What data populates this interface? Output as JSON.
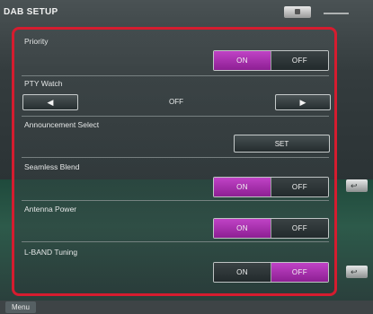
{
  "header": {
    "title": "DAB SETUP"
  },
  "settings": {
    "priority": {
      "label": "Priority",
      "on": "ON",
      "off": "OFF",
      "selected": "ON"
    },
    "pty_watch": {
      "label": "PTY Watch",
      "value": "OFF",
      "left_arrow": "◀",
      "right_arrow": "▶"
    },
    "announcement_select": {
      "label": "Announcement Select",
      "button": "SET"
    },
    "seamless_blend": {
      "label": "Seamless Blend",
      "on": "ON",
      "off": "OFF",
      "selected": "ON"
    },
    "antenna_power": {
      "label": "Antenna Power",
      "on": "ON",
      "off": "OFF",
      "selected": "ON"
    },
    "l_band_tuning": {
      "label": "L-BAND Tuning",
      "on": "ON",
      "off": "OFF",
      "selected": "OFF"
    }
  },
  "footer": {
    "menu_label": "Menu"
  },
  "icons": {
    "back": "return-arrow-icon",
    "left": "left-arrow-icon",
    "right": "right-arrow-icon"
  },
  "colors": {
    "highlight": "#d51c2f",
    "toggle_active": "#b23cb8"
  }
}
